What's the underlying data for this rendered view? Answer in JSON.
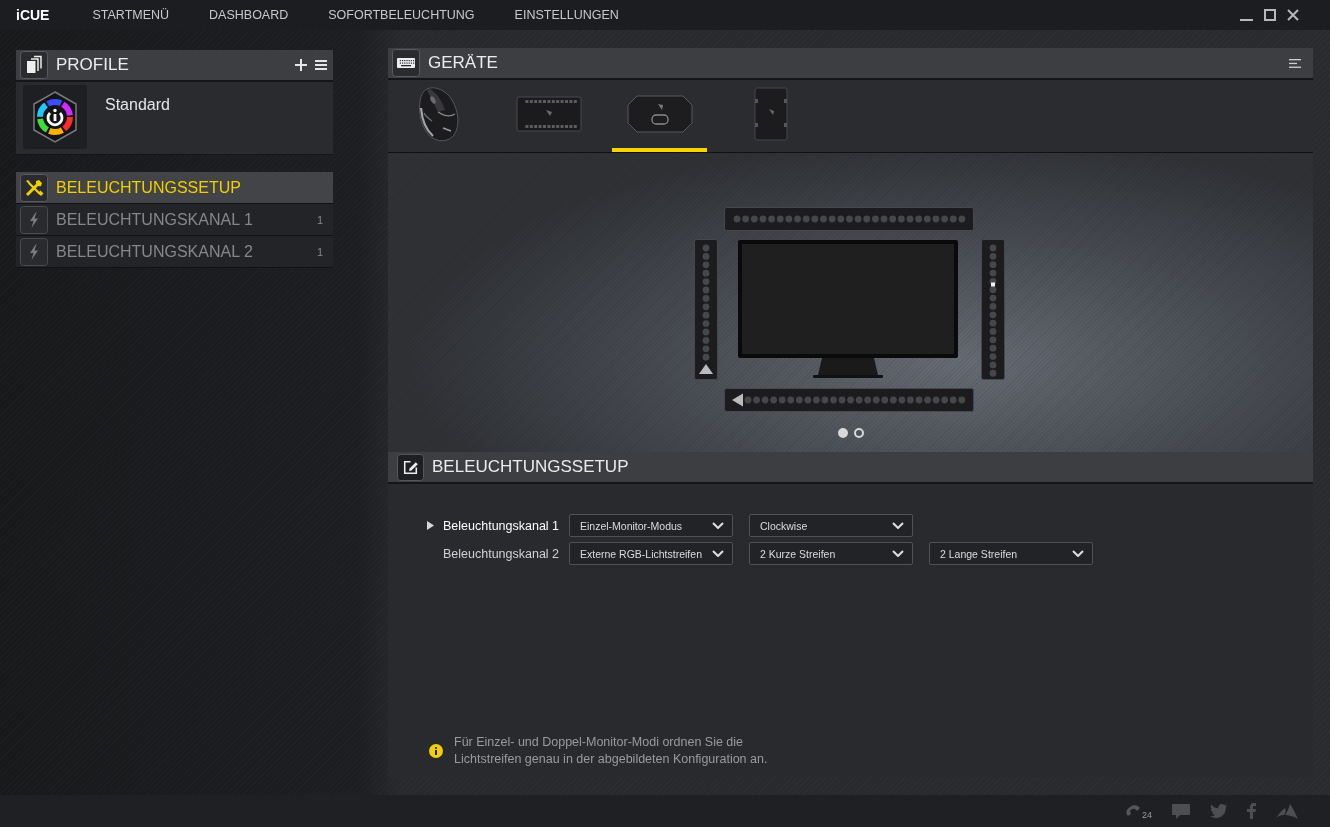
{
  "app": {
    "logo": "iCUE"
  },
  "nav": [
    {
      "label": "STARTMENÜ"
    },
    {
      "label": "DASHBOARD"
    },
    {
      "label": "SOFORTBELEUCHTUNG"
    },
    {
      "label": "EINSTELLUNGEN"
    }
  ],
  "profiles": {
    "title": "PROFILE",
    "items": [
      {
        "name": "Standard"
      }
    ]
  },
  "setup_menu": [
    {
      "kind": "setup",
      "label": "BELEUCHTUNGSSETUP",
      "selected": true
    },
    {
      "kind": "channel",
      "label": "BELEUCHTUNGSKANAL 1",
      "count": "1",
      "selected": false
    },
    {
      "kind": "channel",
      "label": "BELEUCHTUNGSKANAL 2",
      "count": "1",
      "selected": false
    }
  ],
  "devices_panel": {
    "title": "GERÄTE",
    "devices": [
      {
        "kind": "mouse",
        "selected": false
      },
      {
        "kind": "fan-controller",
        "selected": false
      },
      {
        "kind": "monitor-hub",
        "selected": true
      },
      {
        "kind": "lighting-node",
        "selected": false
      }
    ]
  },
  "diagram": {
    "pages": [
      {
        "selected": true
      },
      {
        "selected": false
      }
    ]
  },
  "setup_panel": {
    "title": "BELEUCHTUNGSSETUP",
    "channels": [
      {
        "label": "Beleuchtungskanal 1",
        "selected": true,
        "options": [
          "Einzel-Monitor-Modus",
          "Clockwise"
        ]
      },
      {
        "label": "Beleuchtungskanal 2",
        "selected": false,
        "options": [
          "Externe RGB-Lichtstreifen",
          "2 Kurze Streifen",
          "2 Lange Streifen"
        ]
      }
    ],
    "note": "Für Einzel- und Doppel-Monitor-Modi ordnen Sie die\nLichtstreifen genau in der abgebildeten Konfiguration an."
  },
  "footer": {
    "support_badge": "24"
  }
}
